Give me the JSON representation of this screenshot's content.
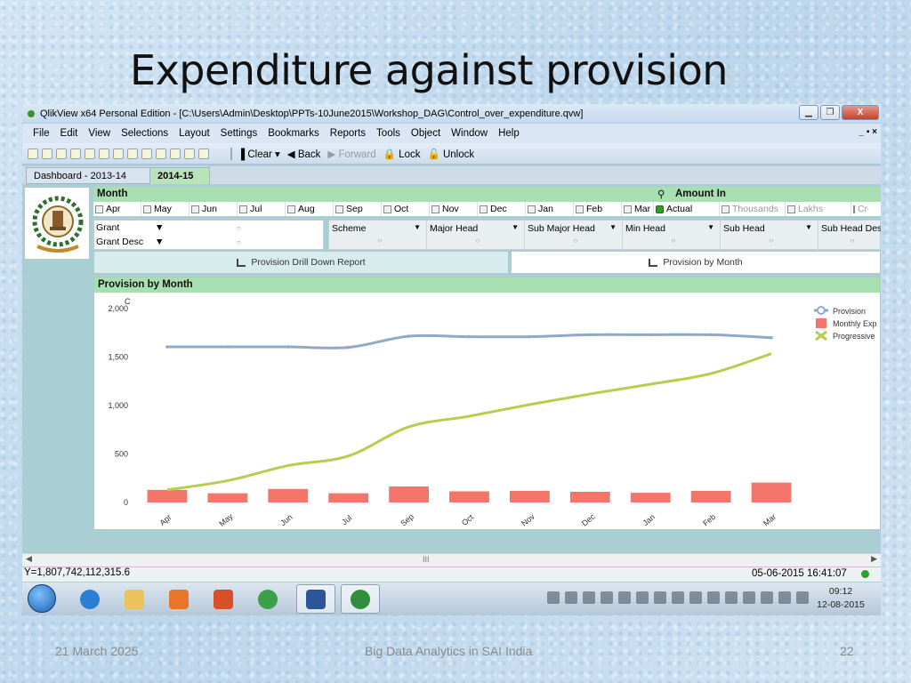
{
  "slide": {
    "title": "Expenditure against provision",
    "footer_date": "21 March 2025",
    "footer_center": "Big Data Analytics in SAI India",
    "footer_page": "22"
  },
  "window": {
    "title": "QlikView x64 Personal Edition - [C:\\Users\\Admin\\Desktop\\PPTs-10June2015\\Workshop_DAG\\Control_over_expenditure.qvw]",
    "min": "▁",
    "max": "❐",
    "close": "X",
    "mdi": "_ ▪ ×"
  },
  "menu": [
    "File",
    "Edit",
    "View",
    "Selections",
    "Layout",
    "Settings",
    "Bookmarks",
    "Reports",
    "Tools",
    "Object",
    "Window",
    "Help"
  ],
  "toolbar": {
    "clear": "Clear",
    "back": "Back",
    "forward": "Forward",
    "lock": "Lock",
    "unlock": "Unlock"
  },
  "tabs": [
    "Dashboard - 2013-14",
    "2014-15"
  ],
  "month_box": {
    "title": "Month",
    "months": [
      "Apr",
      "May",
      "Jun",
      "Jul",
      "Aug",
      "Sep",
      "Oct",
      "Nov",
      "Dec",
      "Jan",
      "Feb",
      "Mar"
    ]
  },
  "amount_box": {
    "title": "Amount In",
    "options": [
      {
        "label": "Actual",
        "selected": true
      },
      {
        "label": "Thousands",
        "selected": false
      },
      {
        "label": "Lakhs",
        "selected": false
      },
      {
        "label": "Cro",
        "selected": false
      }
    ]
  },
  "grant_box": [
    "Grant",
    "Grant Desc"
  ],
  "filters": [
    "Scheme",
    "Major Head",
    "Sub Major Head",
    "Min Head",
    "Sub Head",
    "Sub Head Desc"
  ],
  "buttons": {
    "drill": "Provision Drill Down Report",
    "prov": "Provision by Month"
  },
  "chart_title": "Provision by Month",
  "chart_data": {
    "type": "bar",
    "y_label": "C",
    "ylim": [
      0,
      2000
    ],
    "yticks": [
      "0",
      "500",
      "1,000",
      "1,500",
      "2,000"
    ],
    "categories": [
      "Apr",
      "May",
      "Jun",
      "Jul",
      "Sep",
      "Oct",
      "Nov",
      "Dec",
      "Jan",
      "Feb",
      "Mar"
    ],
    "series": [
      {
        "name": "Provision",
        "kind": "line",
        "color": "#8fa9cb",
        "values": [
          1605,
          1605,
          1605,
          1600,
          1715,
          1710,
          1710,
          1730,
          1730,
          1730,
          1700
        ]
      },
      {
        "name": "Monthly Exp",
        "kind": "bar",
        "color": "#f4756a",
        "values": [
          130,
          95,
          140,
          95,
          165,
          115,
          120,
          110,
          100,
          120,
          205
        ]
      },
      {
        "name": "Progressive",
        "kind": "line",
        "color": "#b4cf4f",
        "values": [
          130,
          225,
          380,
          480,
          780,
          890,
          1010,
          1120,
          1220,
          1330,
          1535
        ]
      }
    ],
    "legend_position": "top-right",
    "grid": false
  },
  "status": {
    "value": "Y=1,807,742,112,315.6",
    "timestamp": "05-06-2015 16:41:07",
    "scroll_grip": "III"
  },
  "taskbar": {
    "time": "09:12",
    "date": "12-08-2015",
    "apps": [
      {
        "name": "internet-explorer",
        "color": "#2a7fd4"
      },
      {
        "name": "file-explorer",
        "color": "#e8c45a"
      },
      {
        "name": "media-player",
        "color": "#e8762a"
      },
      {
        "name": "paint-app",
        "color": "#d8502a"
      },
      {
        "name": "chrome",
        "color": "#3aa14a"
      },
      {
        "name": "word",
        "color": "#2b579a",
        "active": true
      },
      {
        "name": "qlikview",
        "color": "#2f8f3a",
        "active": true
      }
    ]
  }
}
